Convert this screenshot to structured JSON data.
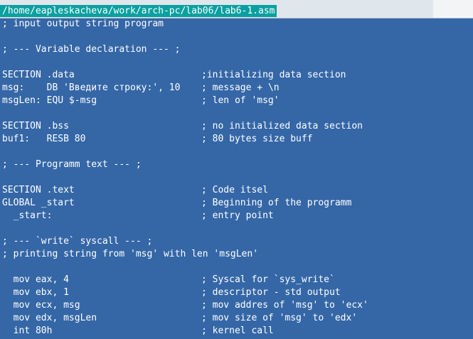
{
  "editor": {
    "file_path": "/home/eapleskacheva/work/arch-pc/lab06/lab6-1.asm",
    "lines": [
      {
        "code": "; input output string program",
        "comment": ""
      },
      {
        "code": "",
        "comment": ""
      },
      {
        "code": "; --- Variable declaration --- ;",
        "comment": ""
      },
      {
        "code": "",
        "comment": ""
      },
      {
        "code": "SECTION .data",
        "comment": ";initializing data section"
      },
      {
        "code": "msg:    DB 'Введите строку:', 10",
        "comment": "; message + \\n"
      },
      {
        "code": "msgLen: EQU $-msg",
        "comment": "; len of 'msg'"
      },
      {
        "code": "",
        "comment": ""
      },
      {
        "code": "SECTION .bss",
        "comment": "; no initialized data section"
      },
      {
        "code": "buf1:   RESB 80",
        "comment": "; 80 bytes size buff"
      },
      {
        "code": "",
        "comment": ""
      },
      {
        "code": "; --- Programm text --- ;",
        "comment": ""
      },
      {
        "code": "",
        "comment": ""
      },
      {
        "code": "SECTION .text",
        "comment": "; Code itsel"
      },
      {
        "code": "GLOBAL _start",
        "comment": "; Beginning of the programm"
      },
      {
        "code": "  _start:",
        "comment": "; entry point"
      },
      {
        "code": "",
        "comment": ""
      },
      {
        "code": "; --- `write` syscall --- ;",
        "comment": ""
      },
      {
        "code": "; printing string from 'msg' with len 'msgLen'",
        "comment": ""
      },
      {
        "code": "",
        "comment": ""
      },
      {
        "code": "  mov eax, 4",
        "comment": "; Syscal for `sys_write`"
      },
      {
        "code": "  mov ebx, 1",
        "comment": "; descriptor - std output"
      },
      {
        "code": "  mov ecx, msg",
        "comment": "; mov addres of 'msg' to 'ecx'"
      },
      {
        "code": "  mov edx, msgLen",
        "comment": "; mov size of 'msg' to 'edx'"
      },
      {
        "code": "  int 80h",
        "comment": "; kernel call"
      }
    ]
  },
  "colors": {
    "background": "#3567a7",
    "path_bar": "#0aa0a0",
    "text": "#ffffff"
  }
}
